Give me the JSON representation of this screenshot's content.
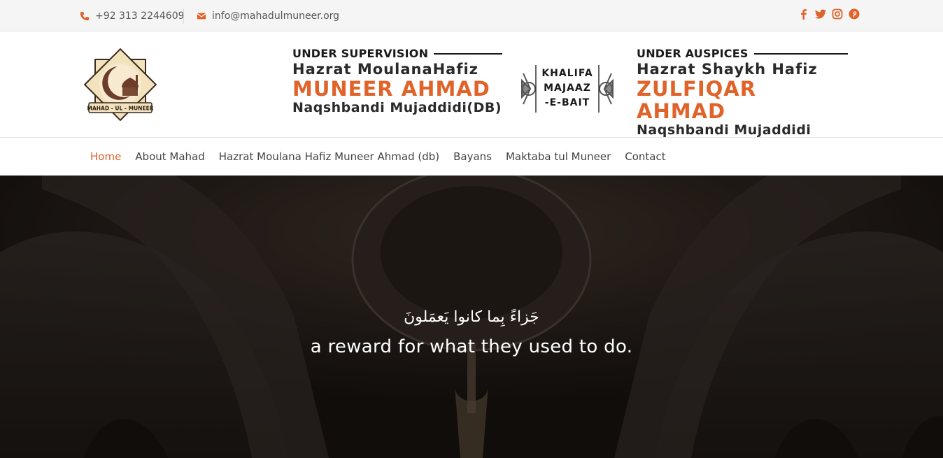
{
  "topbar": {
    "phone": "+92 313 2244609",
    "email": "info@mahadulmuneer.org",
    "social_icons": [
      "facebook-icon",
      "twitter-icon",
      "instagram-icon",
      "pinterest-icon"
    ]
  },
  "header": {
    "logo_text": "MAHAD - UL - MUNEER",
    "left": {
      "kicker": "UNDER SUPERVISION",
      "line1": "Hazrat MoulanaHafiz",
      "line2": "MUNEER AHMAD",
      "line3": "Naqshbandi Mujaddidi(DB)"
    },
    "badge": {
      "line1": "KHALIFA",
      "line2": "MAJAAZ",
      "line3": "-E-BAIT"
    },
    "right": {
      "kicker": "UNDER AUSPICES",
      "line1": "Hazrat Shaykh Hafiz",
      "line2": "ZULFIQAR AHMAD",
      "line3": "Naqshbandi Mujaddidi (DB)"
    }
  },
  "nav": {
    "items": [
      {
        "label": "Home",
        "active": true
      },
      {
        "label": "About Mahad"
      },
      {
        "label": "Hazrat Moulana Hafiz Muneer Ahmad (db)"
      },
      {
        "label": "Bayans"
      },
      {
        "label": "Maktaba tul Muneer"
      },
      {
        "label": "Contact"
      }
    ]
  },
  "hero": {
    "arabic": "جَزاءً بِما كانوا يَعمَلونَ",
    "english": "a reward for what they used to do."
  },
  "colors": {
    "accent": "#e0632a",
    "topbar_bg": "#f5f5f5",
    "hero_bg": "#231d19"
  }
}
